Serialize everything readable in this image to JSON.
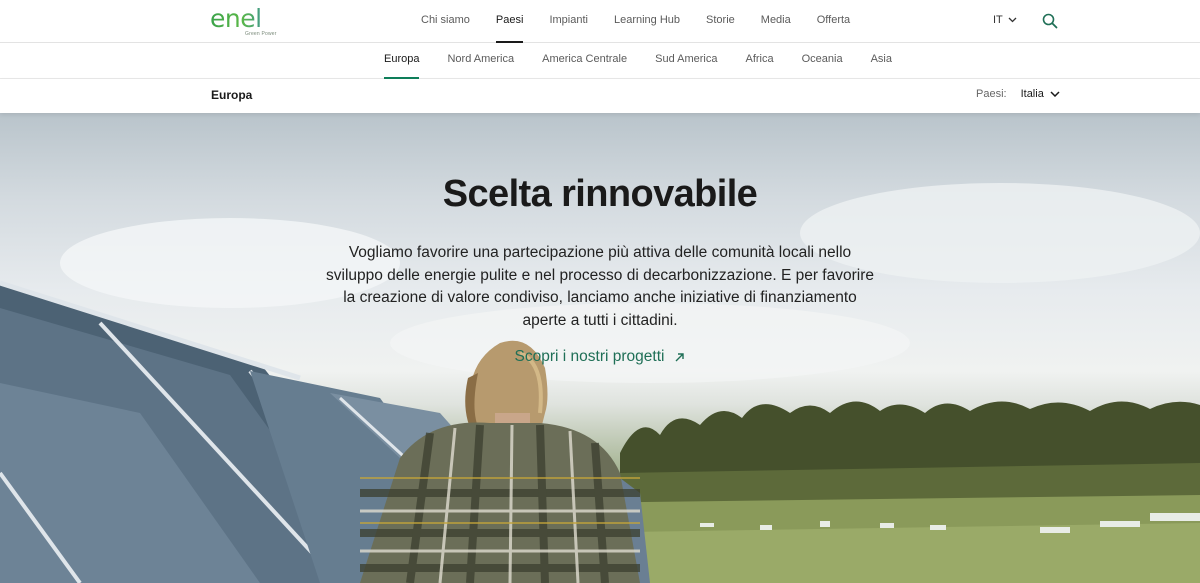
{
  "header": {
    "logo_text": "enel",
    "logo_sub": "Green Power",
    "nav": [
      "Chi siamo",
      "Paesi",
      "Impianti",
      "Learning Hub",
      "Storie",
      "Media",
      "Offerta"
    ],
    "active_nav": "Paesi",
    "language": "IT",
    "search_icon": "search-icon"
  },
  "subnav": {
    "items": [
      "Europa",
      "Nord America",
      "America Centrale",
      "Sud America",
      "Africa",
      "Oceania",
      "Asia"
    ],
    "active": "Europa"
  },
  "region_bar": {
    "title": "Europa",
    "country_label": "Paesi:",
    "country_value": "Italia"
  },
  "hero": {
    "title": "Scelta rinnovabile",
    "text": "Vogliamo favorire una partecipazione più attiva delle comunità locali nello sviluppo delle energie pulite e nel processo di decarbonizzazione. E per favorire la creazione di valore condiviso, lanciamo anche iniziative di finanziamento aperte a tutti i cittadini.",
    "link_label": "Scopri i nostri progetti"
  },
  "colors": {
    "accent": "#0f7f5a",
    "link": "#1f6f56",
    "logo_green": "#3aa24a",
    "logo_blue": "#2e7fc1"
  }
}
